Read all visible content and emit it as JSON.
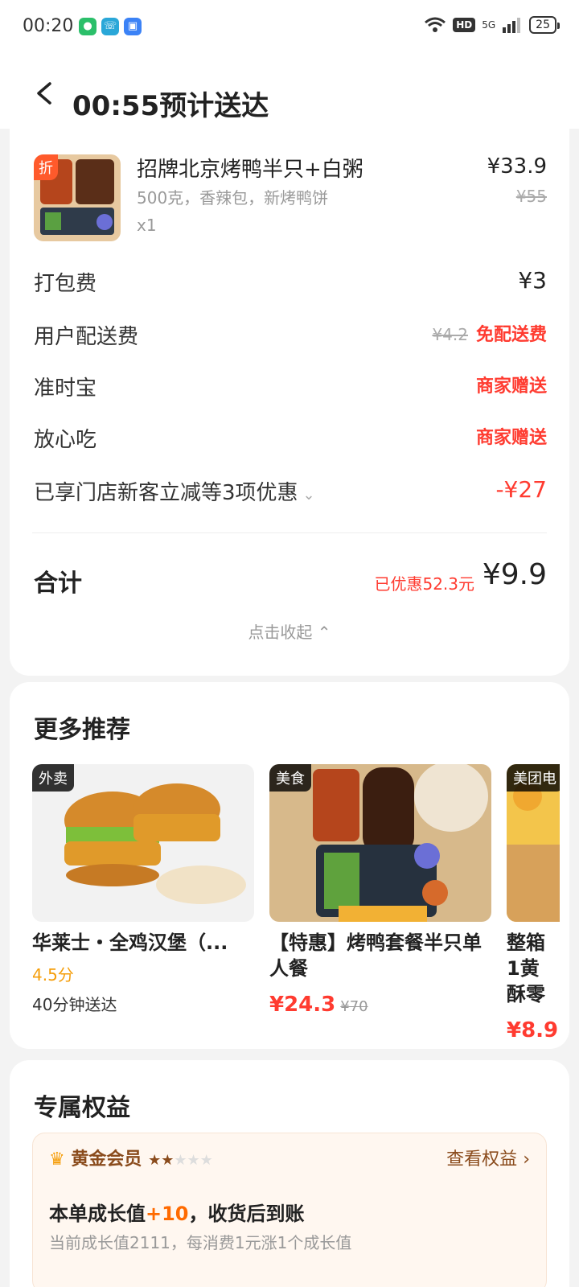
{
  "status_bar": {
    "time": "00:20",
    "battery": "25",
    "network": "5G",
    "hd": "HD"
  },
  "header": {
    "title": "00:55预计送达"
  },
  "order": {
    "item": {
      "name": "招牌北京烤鸭半只+白粥",
      "spec": "500克，香辣包，新烤鸭饼",
      "qty": "x1",
      "price": "¥33.9",
      "orig_price": "¥55",
      "badge": "折"
    },
    "fees": [
      {
        "label": "打包费",
        "value": "¥3"
      },
      {
        "label": "用户配送费",
        "strike": "¥4.2",
        "value": "免配送费"
      },
      {
        "label": "准时宝",
        "value": "商家赠送"
      },
      {
        "label": "放心吃",
        "value": "商家赠送"
      },
      {
        "label": "已享门店新客立减等3项优惠",
        "value": "-¥27"
      }
    ],
    "total_label": "合计",
    "saved": "已优惠52.3元",
    "total": "¥9.9",
    "collapse": "点击收起"
  },
  "recommend": {
    "title": "更多推荐",
    "items": [
      {
        "tag": "外卖",
        "name": "华莱士・全鸡汉堡（...",
        "rating": "4.5分",
        "sub": "40分钟送达"
      },
      {
        "tag": "美食",
        "name": "【特惠】烤鸭套餐半只单人餐",
        "price": "¥24.3",
        "orig": "¥70"
      },
      {
        "tag": "美团电",
        "name": "整箱1黄酥零",
        "price": "¥8.9"
      }
    ]
  },
  "benefits": {
    "title": "专属权益",
    "member": "黄金会员",
    "link": "查看权益",
    "main_a": "本单成长值",
    "main_b": "+10",
    "main_c": "，收货后到账",
    "note": "当前成长值2111，每消费1元涨1个成长值"
  },
  "colors": {
    "accent": "#ff3b30",
    "gold": "#8a4b1c",
    "background": "#f3f3f3"
  }
}
